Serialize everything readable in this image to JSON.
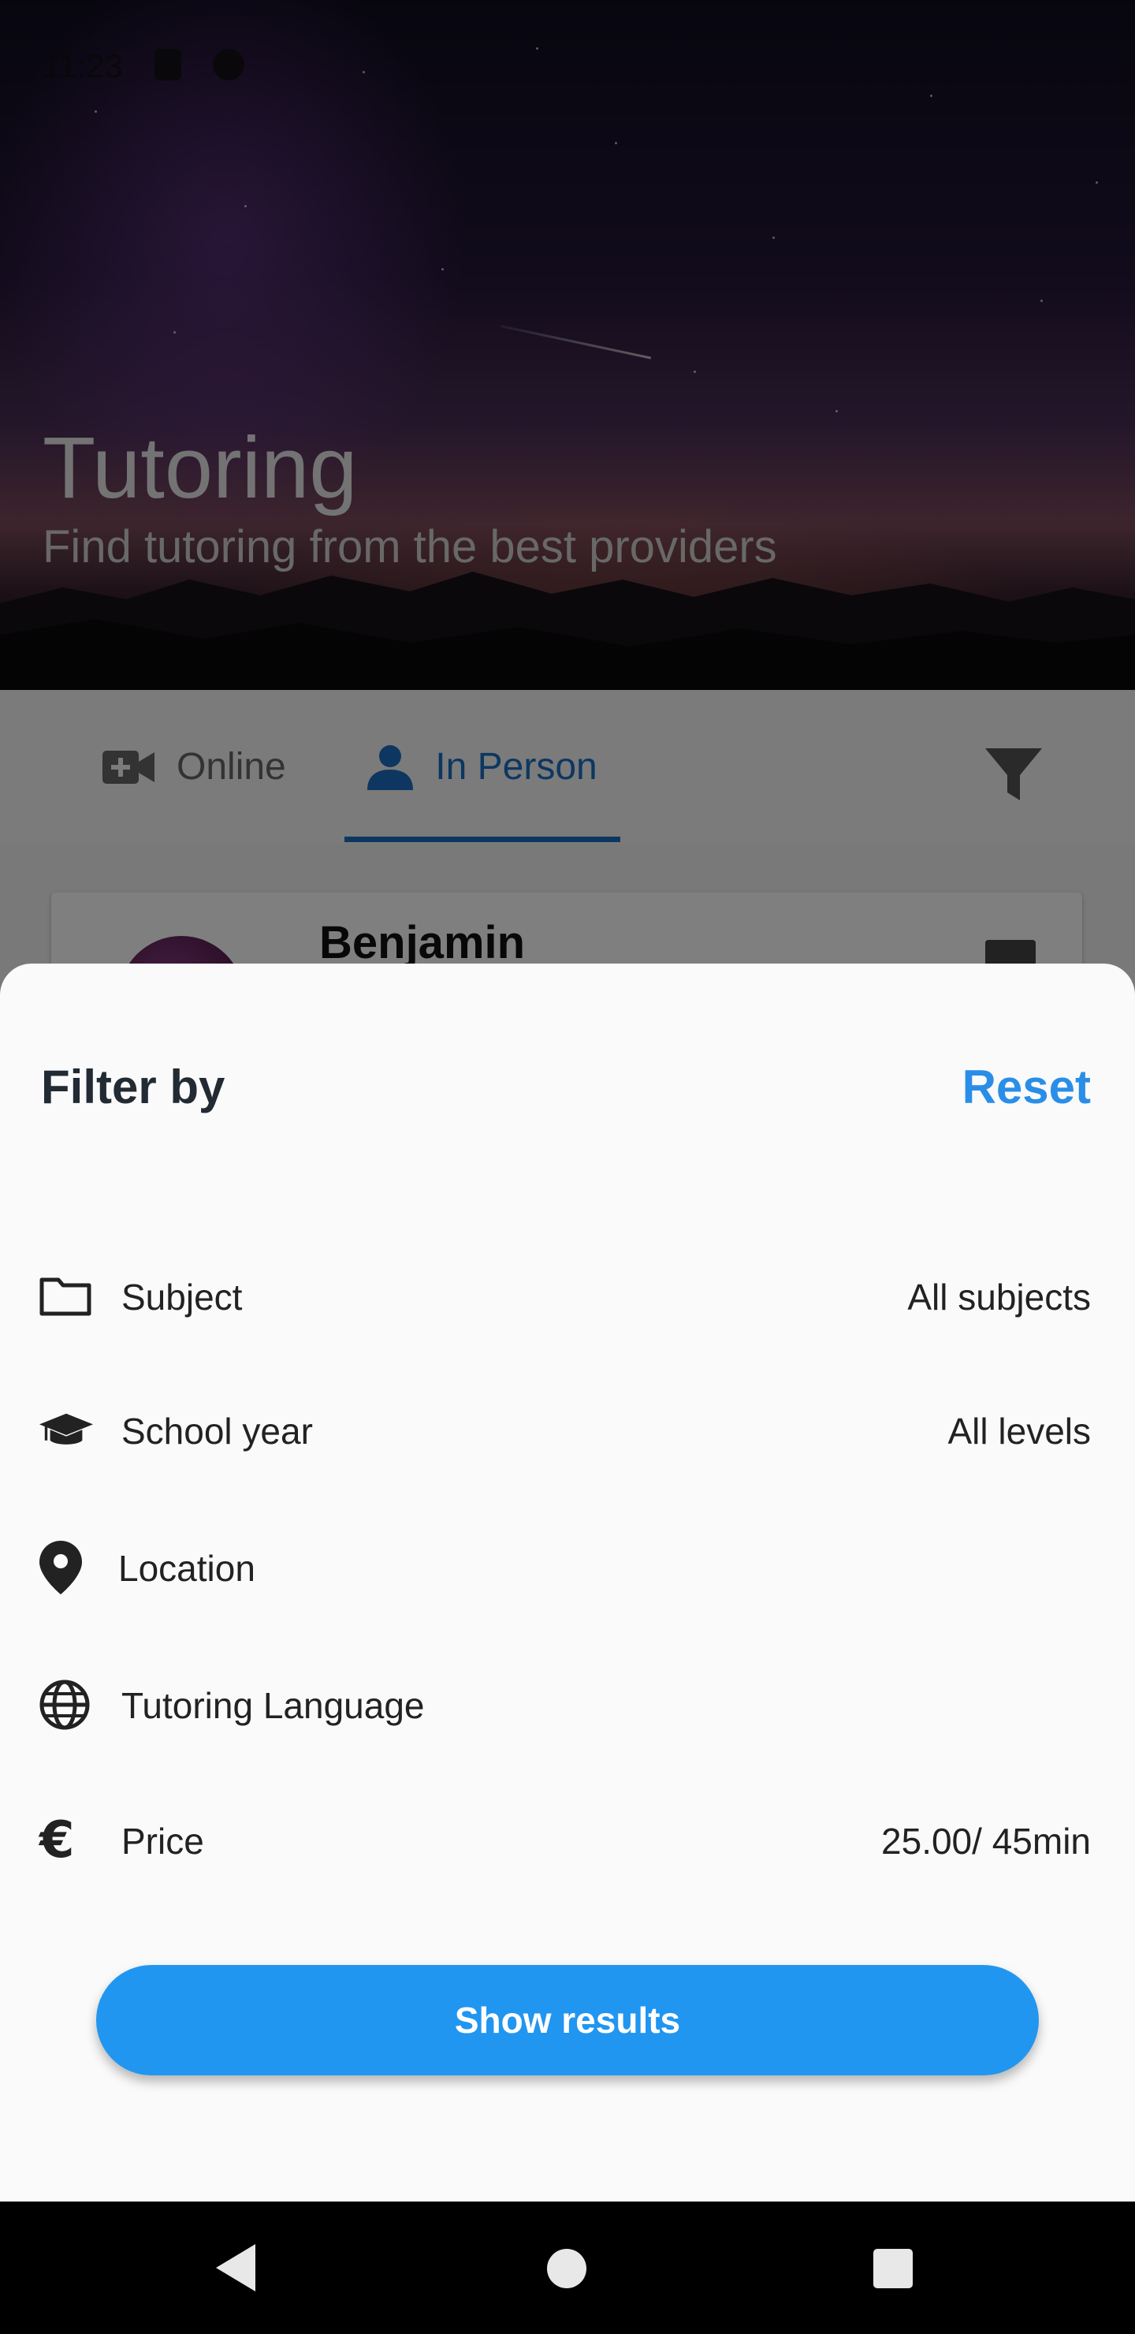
{
  "status_bar": {
    "time": "11:23"
  },
  "hero": {
    "title": "Tutoring",
    "subtitle": "Find tutoring from the best providers"
  },
  "tabs": [
    {
      "label": "Online",
      "icon": "video-camera-icon",
      "selected": false
    },
    {
      "label": "In Person",
      "icon": "person-icon",
      "selected": true
    }
  ],
  "filter_icon": "filter-icon",
  "card": {
    "name": "Benjamin"
  },
  "sheet": {
    "title": "Filter by",
    "reset_label": "Reset",
    "rows": [
      {
        "icon": "folder-icon",
        "label": "Subject",
        "value": "All subjects"
      },
      {
        "icon": "graduation-cap-icon",
        "label": "School year",
        "value": "All levels"
      },
      {
        "icon": "location-pin-icon",
        "label": "Location",
        "value": ""
      },
      {
        "icon": "globe-icon",
        "label": "Tutoring Language",
        "value": ""
      },
      {
        "icon": "euro-icon",
        "label": "Price",
        "value": "25.00/ 45min"
      }
    ],
    "show_results_label": "Show results"
  },
  "colors": {
    "accent": "#2196f0",
    "tab_selected": "#1b6ec2",
    "reset": "#2a8ee8"
  }
}
